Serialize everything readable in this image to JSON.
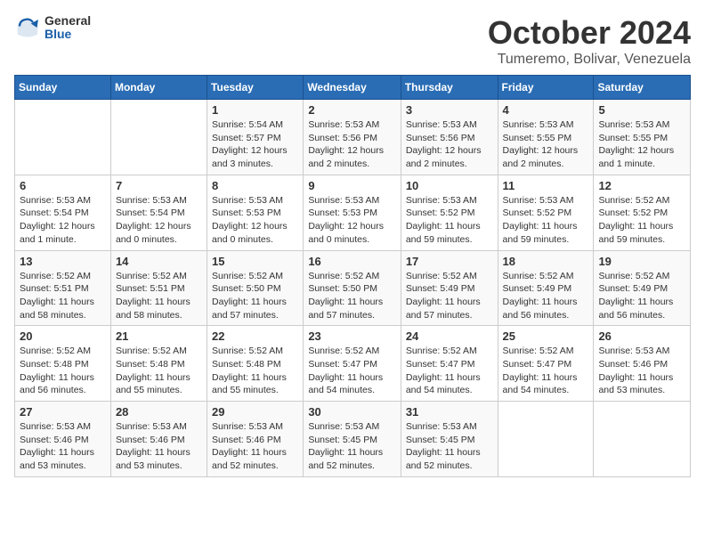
{
  "logo": {
    "general": "General",
    "blue": "Blue"
  },
  "title": "October 2024",
  "location": "Tumeremo, Bolivar, Venezuela",
  "days_header": [
    "Sunday",
    "Monday",
    "Tuesday",
    "Wednesday",
    "Thursday",
    "Friday",
    "Saturday"
  ],
  "weeks": [
    [
      {
        "day": "",
        "info": ""
      },
      {
        "day": "",
        "info": ""
      },
      {
        "day": "1",
        "info": "Sunrise: 5:54 AM\nSunset: 5:57 PM\nDaylight: 12 hours and 3 minutes."
      },
      {
        "day": "2",
        "info": "Sunrise: 5:53 AM\nSunset: 5:56 PM\nDaylight: 12 hours and 2 minutes."
      },
      {
        "day": "3",
        "info": "Sunrise: 5:53 AM\nSunset: 5:56 PM\nDaylight: 12 hours and 2 minutes."
      },
      {
        "day": "4",
        "info": "Sunrise: 5:53 AM\nSunset: 5:55 PM\nDaylight: 12 hours and 2 minutes."
      },
      {
        "day": "5",
        "info": "Sunrise: 5:53 AM\nSunset: 5:55 PM\nDaylight: 12 hours and 1 minute."
      }
    ],
    [
      {
        "day": "6",
        "info": "Sunrise: 5:53 AM\nSunset: 5:54 PM\nDaylight: 12 hours and 1 minute."
      },
      {
        "day": "7",
        "info": "Sunrise: 5:53 AM\nSunset: 5:54 PM\nDaylight: 12 hours and 0 minutes."
      },
      {
        "day": "8",
        "info": "Sunrise: 5:53 AM\nSunset: 5:53 PM\nDaylight: 12 hours and 0 minutes."
      },
      {
        "day": "9",
        "info": "Sunrise: 5:53 AM\nSunset: 5:53 PM\nDaylight: 12 hours and 0 minutes."
      },
      {
        "day": "10",
        "info": "Sunrise: 5:53 AM\nSunset: 5:52 PM\nDaylight: 11 hours and 59 minutes."
      },
      {
        "day": "11",
        "info": "Sunrise: 5:53 AM\nSunset: 5:52 PM\nDaylight: 11 hours and 59 minutes."
      },
      {
        "day": "12",
        "info": "Sunrise: 5:52 AM\nSunset: 5:52 PM\nDaylight: 11 hours and 59 minutes."
      }
    ],
    [
      {
        "day": "13",
        "info": "Sunrise: 5:52 AM\nSunset: 5:51 PM\nDaylight: 11 hours and 58 minutes."
      },
      {
        "day": "14",
        "info": "Sunrise: 5:52 AM\nSunset: 5:51 PM\nDaylight: 11 hours and 58 minutes."
      },
      {
        "day": "15",
        "info": "Sunrise: 5:52 AM\nSunset: 5:50 PM\nDaylight: 11 hours and 57 minutes."
      },
      {
        "day": "16",
        "info": "Sunrise: 5:52 AM\nSunset: 5:50 PM\nDaylight: 11 hours and 57 minutes."
      },
      {
        "day": "17",
        "info": "Sunrise: 5:52 AM\nSunset: 5:49 PM\nDaylight: 11 hours and 57 minutes."
      },
      {
        "day": "18",
        "info": "Sunrise: 5:52 AM\nSunset: 5:49 PM\nDaylight: 11 hours and 56 minutes."
      },
      {
        "day": "19",
        "info": "Sunrise: 5:52 AM\nSunset: 5:49 PM\nDaylight: 11 hours and 56 minutes."
      }
    ],
    [
      {
        "day": "20",
        "info": "Sunrise: 5:52 AM\nSunset: 5:48 PM\nDaylight: 11 hours and 56 minutes."
      },
      {
        "day": "21",
        "info": "Sunrise: 5:52 AM\nSunset: 5:48 PM\nDaylight: 11 hours and 55 minutes."
      },
      {
        "day": "22",
        "info": "Sunrise: 5:52 AM\nSunset: 5:48 PM\nDaylight: 11 hours and 55 minutes."
      },
      {
        "day": "23",
        "info": "Sunrise: 5:52 AM\nSunset: 5:47 PM\nDaylight: 11 hours and 54 minutes."
      },
      {
        "day": "24",
        "info": "Sunrise: 5:52 AM\nSunset: 5:47 PM\nDaylight: 11 hours and 54 minutes."
      },
      {
        "day": "25",
        "info": "Sunrise: 5:52 AM\nSunset: 5:47 PM\nDaylight: 11 hours and 54 minutes."
      },
      {
        "day": "26",
        "info": "Sunrise: 5:53 AM\nSunset: 5:46 PM\nDaylight: 11 hours and 53 minutes."
      }
    ],
    [
      {
        "day": "27",
        "info": "Sunrise: 5:53 AM\nSunset: 5:46 PM\nDaylight: 11 hours and 53 minutes."
      },
      {
        "day": "28",
        "info": "Sunrise: 5:53 AM\nSunset: 5:46 PM\nDaylight: 11 hours and 53 minutes."
      },
      {
        "day": "29",
        "info": "Sunrise: 5:53 AM\nSunset: 5:46 PM\nDaylight: 11 hours and 52 minutes."
      },
      {
        "day": "30",
        "info": "Sunrise: 5:53 AM\nSunset: 5:45 PM\nDaylight: 11 hours and 52 minutes."
      },
      {
        "day": "31",
        "info": "Sunrise: 5:53 AM\nSunset: 5:45 PM\nDaylight: 11 hours and 52 minutes."
      },
      {
        "day": "",
        "info": ""
      },
      {
        "day": "",
        "info": ""
      }
    ]
  ]
}
